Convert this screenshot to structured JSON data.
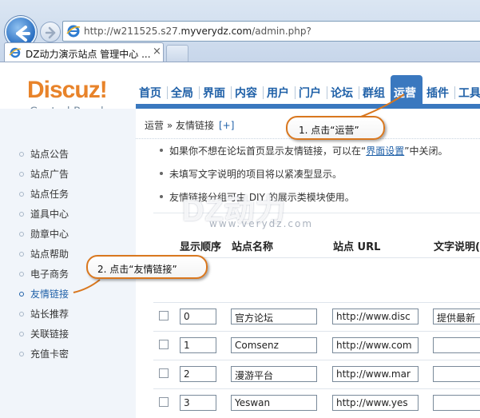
{
  "browser": {
    "url_prefix": "http://w211525.s27.",
    "url_domain": "myverydz.com",
    "url_suffix": "/admin.php?",
    "tab_title": "DZ动力演示站点 管理中心 ...",
    "tab_close": "×"
  },
  "header": {
    "logo": "Discuz!",
    "subtitle": "Control Panel",
    "nav": [
      "首页",
      "全局",
      "界面",
      "内容",
      "用户",
      "门户",
      "论坛",
      "群组",
      "运营",
      "插件",
      "工具"
    ],
    "active_nav": "运营"
  },
  "sidebar": {
    "items": [
      "站点公告",
      "站点广告",
      "站点任务",
      "道具中心",
      "勋章中心",
      "站点帮助",
      "电子商务",
      "友情链接",
      "站长推荐",
      "关联链接",
      "充值卡密"
    ],
    "active_item": "友情链接"
  },
  "breadcrumb": {
    "text": "运营 » 友情链接",
    "add": "[+]"
  },
  "tips": {
    "tip1_before": "如果你不想在论坛首页显示友情链接，可以在“",
    "tip1_link": "界面设置",
    "tip1_after": "”中关闭。",
    "tip2": "未填写文字说明的项目将以紧凑型显示。",
    "tip3": "友情链接分组可由 DIY 的展示类模块使用。"
  },
  "watermark": {
    "main": "DZ动力",
    "sub": "www.verydz.com"
  },
  "table": {
    "headers": {
      "order": "显示顺序",
      "name": "站点名称",
      "url": "站点 URL",
      "desc": "文字说明("
    },
    "rows": [
      {
        "order": "0",
        "name": "官方论坛",
        "url": "http://www.disc",
        "desc": "提供最新"
      },
      {
        "order": "1",
        "name": "Comsenz",
        "url": "http://www.com",
        "desc": ""
      },
      {
        "order": "2",
        "name": "漫游平台",
        "url": "http://www.mar",
        "desc": ""
      },
      {
        "order": "3",
        "name": "Yeswan",
        "url": "http://www.yes",
        "desc": ""
      }
    ]
  },
  "callouts": {
    "step1": "1. 点击“运营”",
    "step2": "2. 点击“友情链接”"
  },
  "colors": {
    "accent_blue": "#3a78bf",
    "link_blue": "#2061a8",
    "logo_orange": "#e8832a",
    "callout_border": "#d9771e"
  }
}
